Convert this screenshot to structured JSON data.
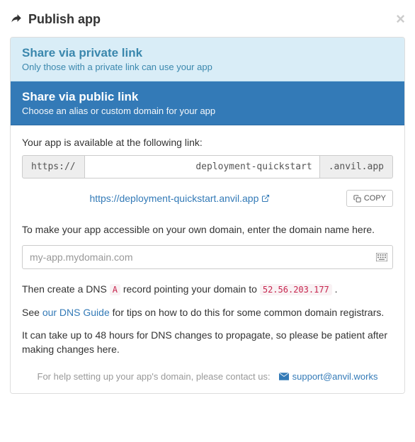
{
  "header": {
    "title": "Publish app"
  },
  "sections": {
    "private": {
      "title": "Share via private link",
      "subtitle": "Only those with a private link can use your app"
    },
    "public": {
      "title": "Share via public link",
      "subtitle": "Choose an alias or custom domain for your app"
    }
  },
  "body": {
    "available_text": "Your app is available at the following link:",
    "protocol": "https://",
    "slug": "deployment-quickstart",
    "suffix": ".anvil.app",
    "full_url": "https://deployment-quickstart.anvil.app",
    "copy_label": "COPY",
    "domain_intro": "To make your app accessible on your own domain, enter the domain name here.",
    "domain_placeholder": "my-app.mydomain.com",
    "dns_prefix": "Then create a DNS ",
    "dns_record_type": "A",
    "dns_middle": " record pointing your domain to ",
    "dns_ip": "52.56.203.177",
    "dns_suffix": " .",
    "guide_prefix": "See ",
    "guide_link": "our DNS Guide",
    "guide_suffix": " for tips on how to do this for some common domain registrars.",
    "propagate_text": "It can take up to 48 hours for DNS changes to propagate, so please be patient after making changes here.",
    "help_text": "For help setting up your app's domain, please contact us:",
    "support_email": "support@anvil.works"
  }
}
